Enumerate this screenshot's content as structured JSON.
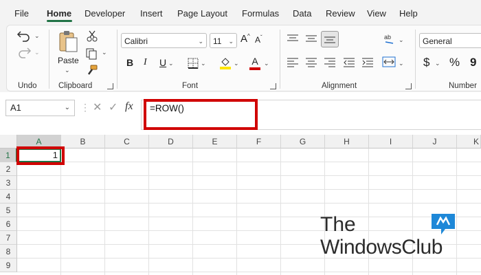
{
  "menu": {
    "tabs": [
      "File",
      "Home",
      "Developer",
      "Insert",
      "Page Layout",
      "Formulas",
      "Data",
      "Review",
      "View",
      "Help"
    ],
    "active": "Home"
  },
  "ribbon": {
    "groups": {
      "undo": "Undo",
      "clipboard": "Clipboard",
      "font": "Font",
      "alignment": "Alignment",
      "number": "Number"
    },
    "paste_label": "Paste",
    "font_name": "Calibri",
    "font_size": "11",
    "number_format": "General"
  },
  "formula_bar": {
    "name_box": "A1",
    "fx_label": "fx",
    "formula": "=ROW()"
  },
  "sheet": {
    "columns": [
      "A",
      "B",
      "C",
      "D",
      "E",
      "F",
      "G",
      "H",
      "I",
      "J",
      "K"
    ],
    "rows": [
      "1",
      "2",
      "3",
      "4",
      "5",
      "6",
      "7",
      "8",
      "9"
    ],
    "cell_A1_value": "1",
    "selected_cell": "A1"
  },
  "watermark": {
    "line1": "The",
    "line2": "WindowsClub"
  },
  "colors": {
    "accent": "#217346",
    "highlight": "#d00000",
    "logo_blue": "#1e88d8"
  }
}
